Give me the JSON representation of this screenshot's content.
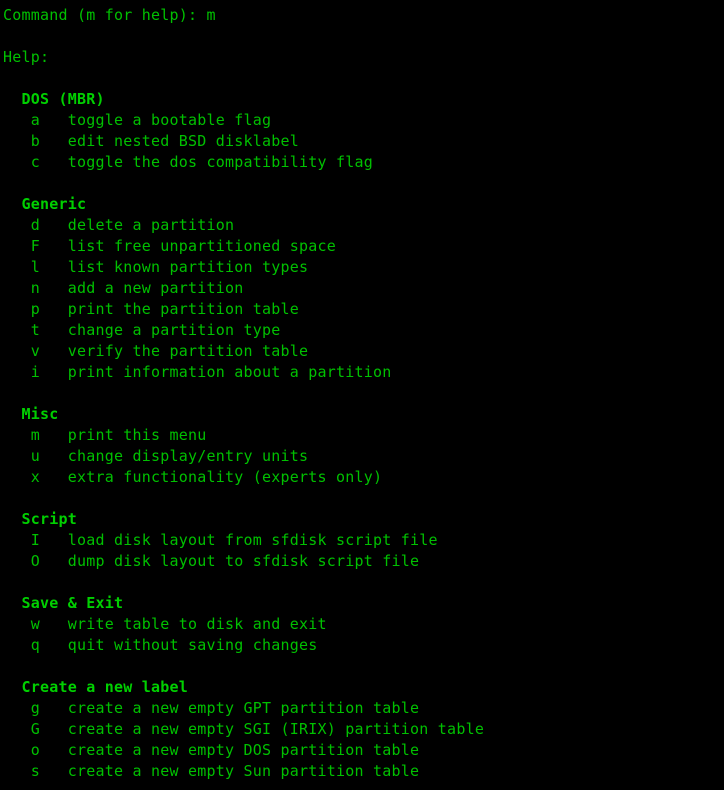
{
  "terminal": {
    "background_color": "#000000",
    "text_color": "#00c000",
    "header_color": "#00d000",
    "prompt_line": "Command (m for help): m",
    "help_label": "Help:",
    "sections": [
      {
        "title": "DOS (MBR)",
        "entries": [
          {
            "key": "a",
            "desc": "toggle a bootable flag"
          },
          {
            "key": "b",
            "desc": "edit nested BSD disklabel"
          },
          {
            "key": "c",
            "desc": "toggle the dos compatibility flag"
          }
        ]
      },
      {
        "title": "Generic",
        "entries": [
          {
            "key": "d",
            "desc": "delete a partition"
          },
          {
            "key": "F",
            "desc": "list free unpartitioned space"
          },
          {
            "key": "l",
            "desc": "list known partition types"
          },
          {
            "key": "n",
            "desc": "add a new partition"
          },
          {
            "key": "p",
            "desc": "print the partition table"
          },
          {
            "key": "t",
            "desc": "change a partition type"
          },
          {
            "key": "v",
            "desc": "verify the partition table"
          },
          {
            "key": "i",
            "desc": "print information about a partition"
          }
        ]
      },
      {
        "title": "Misc",
        "entries": [
          {
            "key": "m",
            "desc": "print this menu"
          },
          {
            "key": "u",
            "desc": "change display/entry units"
          },
          {
            "key": "x",
            "desc": "extra functionality (experts only)"
          }
        ]
      },
      {
        "title": "Script",
        "entries": [
          {
            "key": "I",
            "desc": "load disk layout from sfdisk script file"
          },
          {
            "key": "O",
            "desc": "dump disk layout to sfdisk script file"
          }
        ]
      },
      {
        "title": "Save & Exit",
        "entries": [
          {
            "key": "w",
            "desc": "write table to disk and exit"
          },
          {
            "key": "q",
            "desc": "quit without saving changes"
          }
        ]
      },
      {
        "title": "Create a new label",
        "entries": [
          {
            "key": "g",
            "desc": "create a new empty GPT partition table"
          },
          {
            "key": "G",
            "desc": "create a new empty SGI (IRIX) partition table"
          },
          {
            "key": "o",
            "desc": "create a new empty DOS partition table"
          },
          {
            "key": "s",
            "desc": "create a new empty Sun partition table"
          }
        ]
      }
    ]
  }
}
